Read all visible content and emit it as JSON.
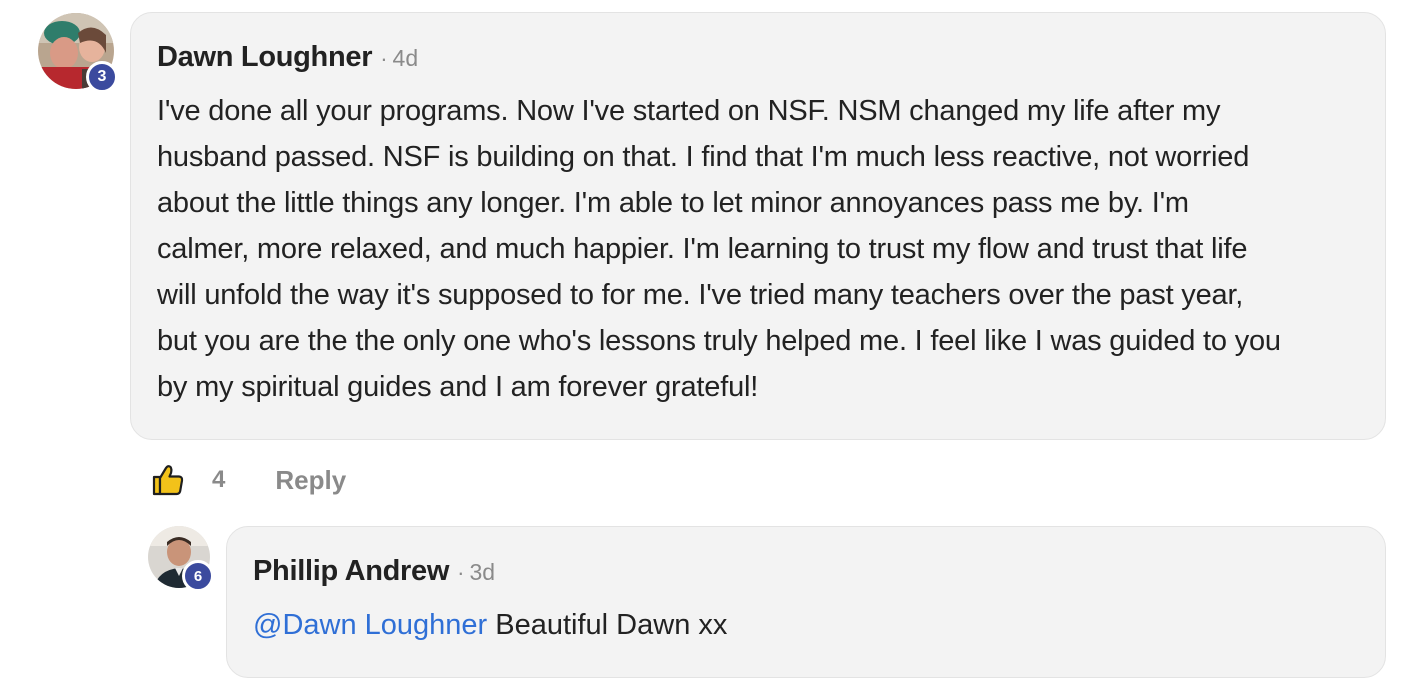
{
  "comment": {
    "author": "Dawn Loughner",
    "separator": "·",
    "timestamp": "4d",
    "level_badge": "3",
    "text": "I've done all your programs. Now I've started on NSF. NSM changed my life after my\nhusband passed. NSF is building on that. I find that I'm much less reactive, not worried\nabout the little things any longer. I'm able to let minor annoyances pass me by. I'm\ncalmer, more relaxed, and much happier. I'm learning to trust my flow and trust that life\nwill unfold the way it's supposed to for me. I've tried many teachers over the past year,\nbut you are the the only one who's lessons truly helped me. I feel like I was guided to you\nby my spiritual guides and I am forever grateful!",
    "like_icon": "thumbs-up-icon",
    "like_count": "4",
    "reply_label": "Reply"
  },
  "reply": {
    "author": "Phillip Andrew",
    "separator": "·",
    "timestamp": "3d",
    "level_badge": "6",
    "mention": "@Dawn Loughner",
    "text": " Beautiful Dawn xx"
  },
  "colors": {
    "bubble_bg": "#f3f3f3",
    "badge_bg": "#3b4a9e",
    "mention": "#2f6fd6",
    "muted": "#8a8a8a"
  }
}
